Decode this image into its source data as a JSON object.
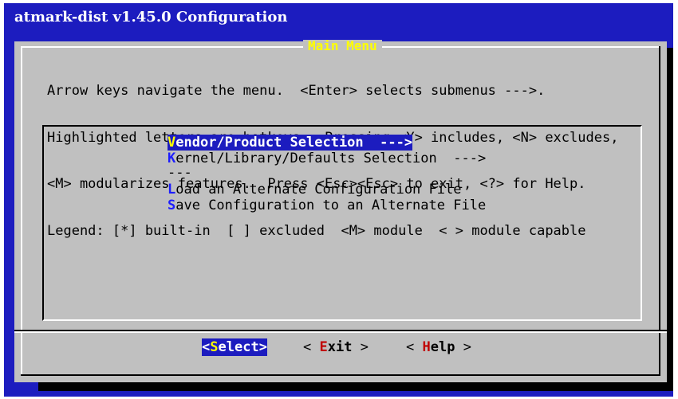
{
  "window": {
    "backtitle": "atmark-dist v1.45.0 Configuration"
  },
  "dialog": {
    "title": "Main Menu",
    "help_lines": [
      "Arrow keys navigate the menu.  <Enter> selects submenus --->.",
      "Highlighted letters are hotkeys.  Pressing <Y> includes, <N> excludes,",
      "<M> modularizes features.  Press <Esc><Esc> to exit, <?> for Help.",
      "Legend: [*] built-in  [ ] excluded  <M> module  < > module capable"
    ],
    "menu": {
      "items": [
        {
          "hotkey": "V",
          "rest": "endor/Product Selection  --->",
          "selected": true
        },
        {
          "hotkey": "K",
          "rest": "ernel/Library/Defaults Selection  --->",
          "selected": false
        },
        {
          "hotkey": "",
          "rest": "---",
          "selected": false
        },
        {
          "hotkey": "L",
          "rest": "oad an Alternate Configuration File",
          "selected": false
        },
        {
          "hotkey": "S",
          "rest": "ave Configuration to an Alternate File",
          "selected": false
        }
      ]
    },
    "buttons": {
      "select": {
        "open": "<",
        "hotkey": "S",
        "rest": "elect",
        "close": ">"
      },
      "exit": {
        "open": "< ",
        "hotkey": "E",
        "rest": "xit",
        "close": " >"
      },
      "help": {
        "open": "< ",
        "hotkey": "H",
        "rest": "elp",
        "close": " >"
      }
    }
  },
  "colors": {
    "screen_bg": "#1c1cbf",
    "dialog_bg": "#c0c0c0",
    "highlight": "#1c1cbf",
    "hotkey_selected": "#ffff00",
    "hotkey": "#1c1cff",
    "button_hotkey": "#c00000"
  }
}
